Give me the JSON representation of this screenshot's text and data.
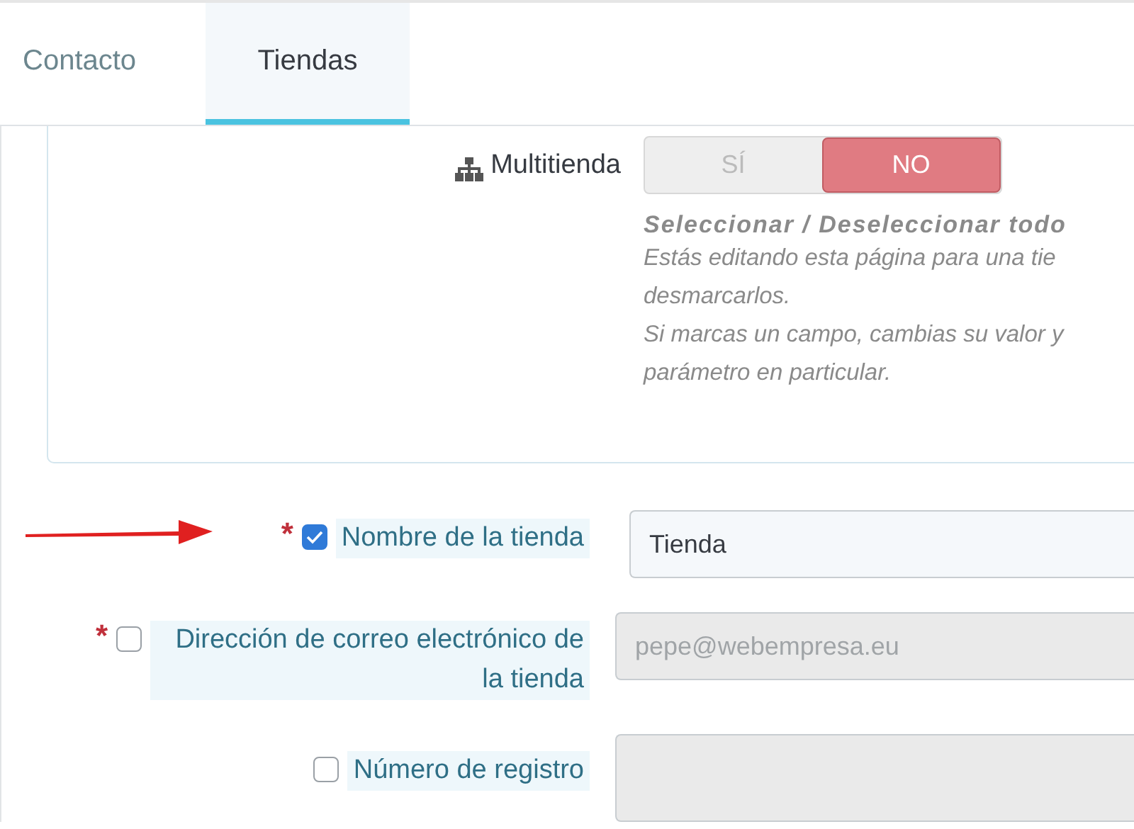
{
  "tabs": [
    {
      "label": "Contacto",
      "selected": false
    },
    {
      "label": "Tiendas",
      "selected": true
    }
  ],
  "multistore": {
    "label": "Multitienda",
    "options": [
      {
        "label": "SÍ",
        "selected": false
      },
      {
        "label": "NO",
        "selected": true
      }
    ],
    "help_title": "Seleccionar / Deseleccionar todo",
    "help_lines": [
      "Estás editando esta página para una tie",
      "desmarcarlos.",
      "Si marcas un campo, cambias su valor y",
      "parámetro en particular."
    ]
  },
  "fields": [
    {
      "label": "Nombre de la tienda",
      "required_mark": "*",
      "checked": true,
      "value": "Tienda",
      "disabled": false,
      "kind": "input"
    },
    {
      "label": "Dirección de correo electrónico de la tienda",
      "required_mark": "*",
      "checked": false,
      "value": "pepe@webempresa.eu",
      "disabled": true,
      "kind": "input"
    },
    {
      "label": "Número de registro",
      "checked": false,
      "disabled": true,
      "kind": "textarea"
    }
  ]
}
